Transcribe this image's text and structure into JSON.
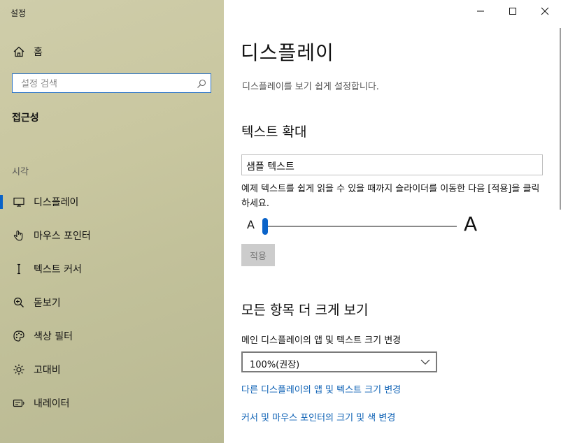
{
  "window": {
    "title": "설정"
  },
  "sidebar": {
    "home_label": "홈",
    "search_placeholder": "설정 검색",
    "group_title": "접근성",
    "section_title": "시각",
    "items": [
      {
        "label": "디스플레이",
        "icon": "monitor-icon",
        "active": true
      },
      {
        "label": "마우스 포인터",
        "icon": "mouse-pointer-icon"
      },
      {
        "label": "텍스트 커서",
        "icon": "text-cursor-icon"
      },
      {
        "label": "돋보기",
        "icon": "magnifier-icon"
      },
      {
        "label": "색상 필터",
        "icon": "palette-icon"
      },
      {
        "label": "고대비",
        "icon": "contrast-icon"
      },
      {
        "label": "내레이터",
        "icon": "narrator-icon"
      }
    ]
  },
  "main": {
    "title": "디스플레이",
    "description": "디스플레이를 보기 쉽게 설정합니다.",
    "text_size": {
      "heading": "텍스트 확대",
      "sample": "샘플 텍스트",
      "instruction": "예제 텍스트를 쉽게 읽을 수 있을 때까지 슬라이더를 이동한 다음 [적용]을 클릭하세요.",
      "slider_min_label": "A",
      "slider_max_label": "A",
      "slider_value": 0,
      "apply_label": "적용"
    },
    "make_bigger": {
      "heading": "모든 항목 더 크게 보기",
      "field_label": "메인 디스플레이의 앱 및 텍스트 크기 변경",
      "selected": "100%(권장)",
      "link1": "다른 디스플레이의 앱 및 텍스트 크기 변경",
      "link2": "커서 및 마우스 포인터의 크기 및 색 변경"
    }
  },
  "colors": {
    "accent": "#0a63c9",
    "link": "#0a5fb4"
  }
}
